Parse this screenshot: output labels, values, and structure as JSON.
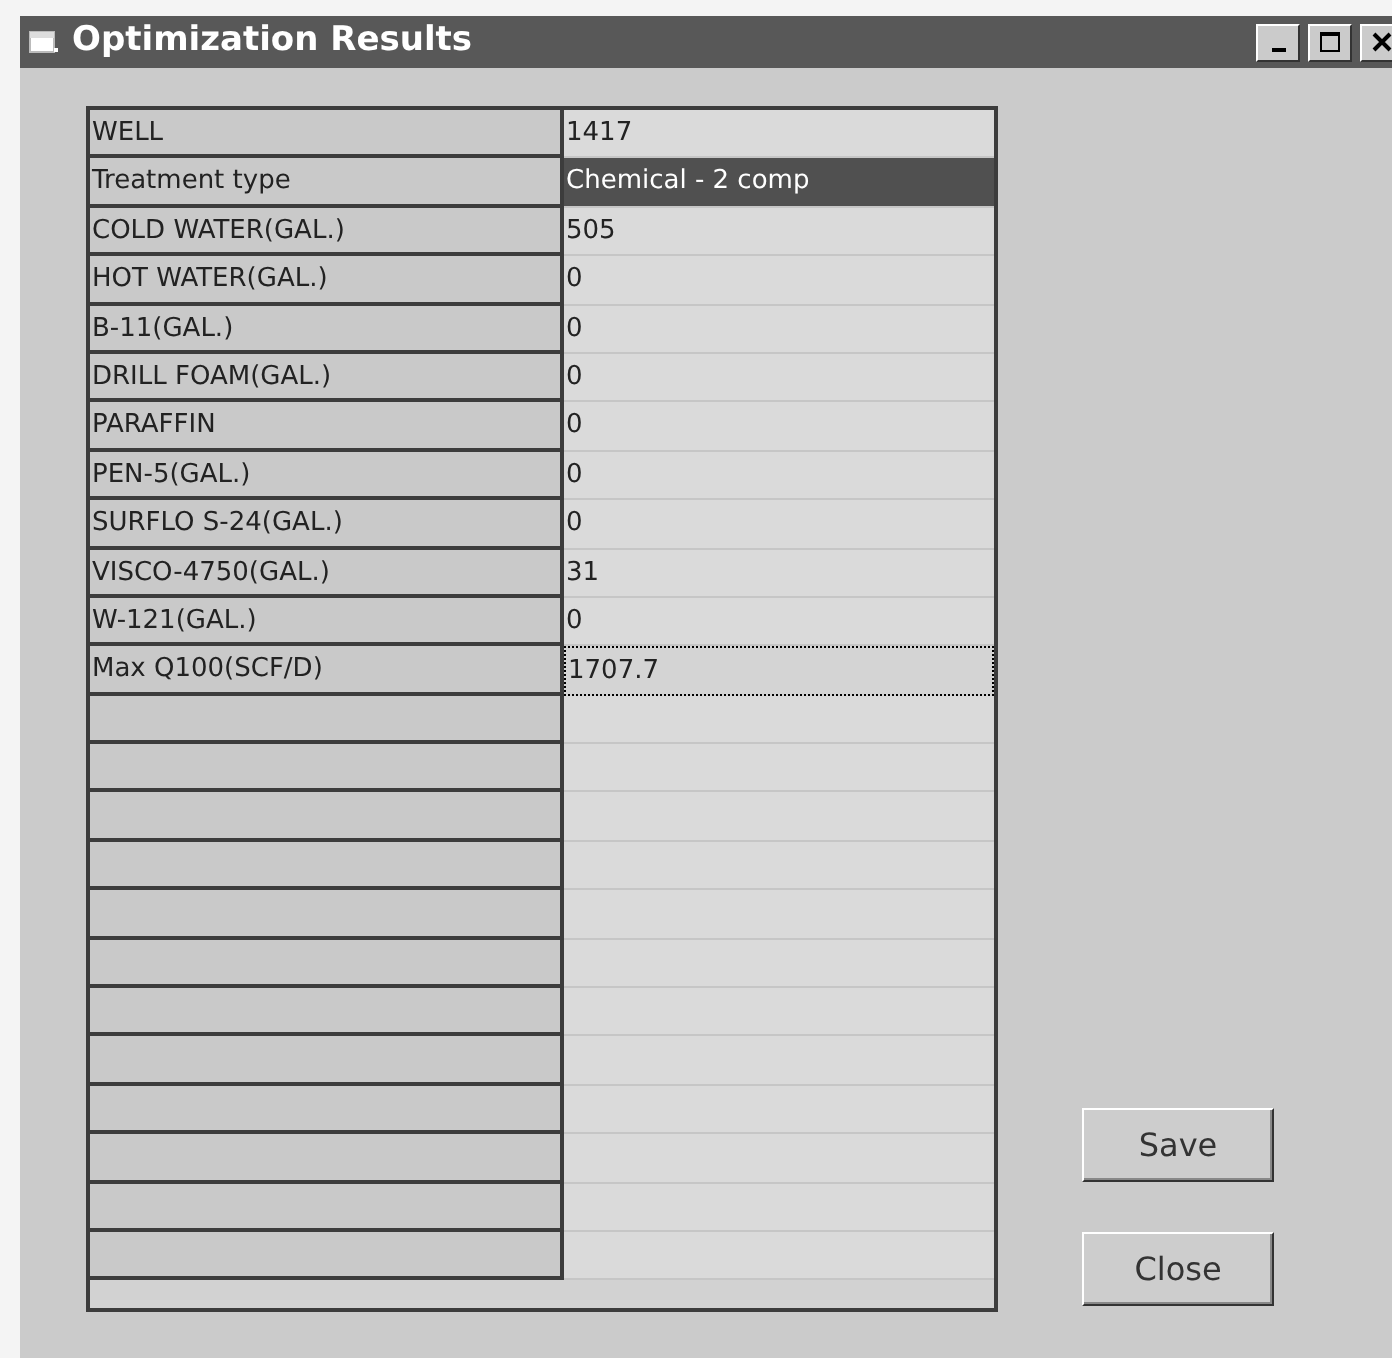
{
  "window": {
    "title": "Optimization Results"
  },
  "grid": {
    "rows": [
      {
        "label": "WELL",
        "value": "1417",
        "selected": false,
        "focused": false
      },
      {
        "label": "Treatment type",
        "value": "Chemical - 2 comp",
        "selected": true,
        "focused": false
      },
      {
        "label": "COLD WATER(GAL.)",
        "value": "505",
        "selected": false,
        "focused": false
      },
      {
        "label": "HOT WATER(GAL.)",
        "value": "0",
        "selected": false,
        "focused": false
      },
      {
        "label": "B-11(GAL.)",
        "value": "0",
        "selected": false,
        "focused": false
      },
      {
        "label": "DRILL FOAM(GAL.)",
        "value": "0",
        "selected": false,
        "focused": false
      },
      {
        "label": "PARAFFIN",
        "value": "0",
        "selected": false,
        "focused": false
      },
      {
        "label": "PEN-5(GAL.)",
        "value": "0",
        "selected": false,
        "focused": false
      },
      {
        "label": "SURFLO S-24(GAL.)",
        "value": "0",
        "selected": false,
        "focused": false
      },
      {
        "label": "VISCO-4750(GAL.)",
        "value": "31",
        "selected": false,
        "focused": false
      },
      {
        "label": "W-121(GAL.)",
        "value": "0",
        "selected": false,
        "focused": false
      },
      {
        "label": "Max Q100(SCF/D)",
        "value": "1707.7",
        "selected": false,
        "focused": true
      }
    ]
  },
  "buttons": [
    {
      "label": "Save"
    },
    {
      "label": "Close"
    }
  ]
}
